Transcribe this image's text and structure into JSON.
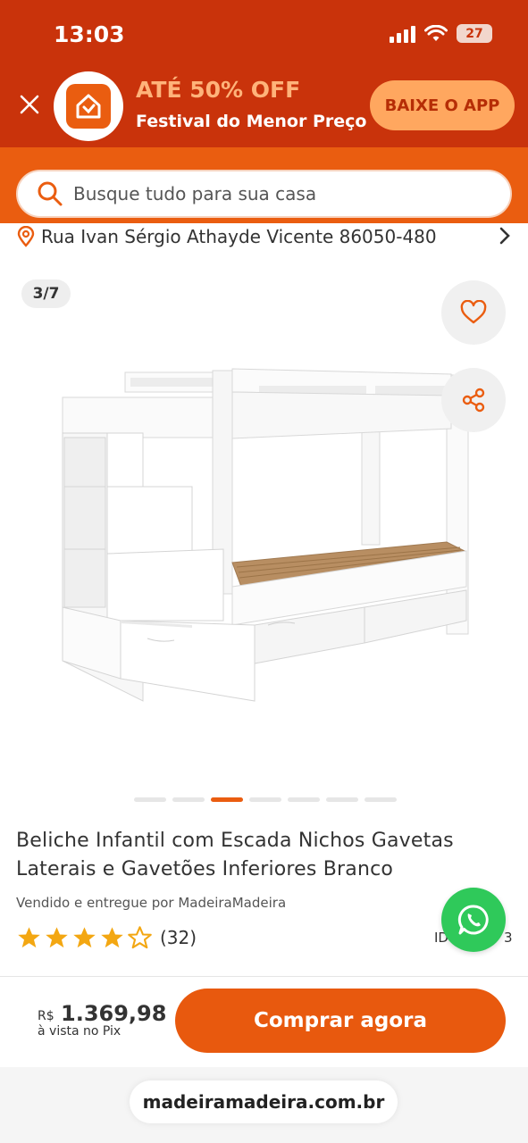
{
  "status_bar": {
    "time": "13:03",
    "battery": "27"
  },
  "promo_banner": {
    "title": "ATÉ 50% OFF",
    "subtitle": "Festival do Menor Preço",
    "app_button": "BAIXE O APP",
    "close_icon": "close-icon"
  },
  "search": {
    "placeholder": "Busque tudo para sua casa"
  },
  "address": {
    "text": "Rua Ivan Sérgio Athayde Vicente 86050-480"
  },
  "gallery": {
    "counter": "3/7",
    "total_images": 7,
    "active_index": 3
  },
  "product": {
    "title": "Beliche Infantil com Escada Nichos Gavetas Laterais e Gavetões Inferiores Branco",
    "seller": "Vendido e entregue por MadeiraMadeira",
    "rating": 4.5,
    "rating_count": "(32)",
    "id_partial": "ID",
    "id_suffix": "3"
  },
  "purchase": {
    "currency": "R$",
    "price": "1.369,98",
    "price_note": "à vista no Pix",
    "buy_button": "Comprar agora"
  },
  "browser": {
    "url": "madeiramadeira.com.br"
  },
  "colors": {
    "banner_dark": "#c9330b",
    "brand_orange": "#ea5d10",
    "promo_accent": "#ffb37a",
    "star": "#f3a712",
    "whatsapp": "#2fc95a"
  }
}
